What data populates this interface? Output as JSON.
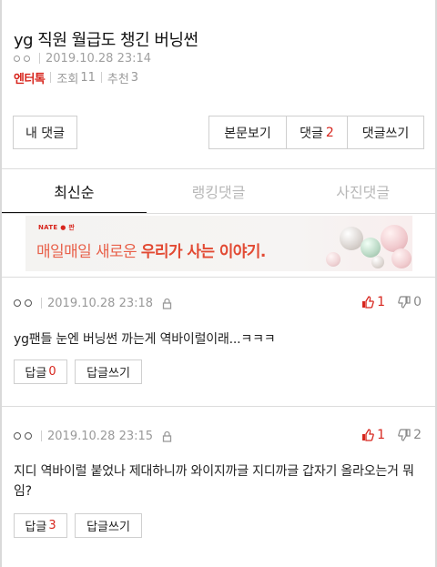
{
  "post": {
    "title": "yg 직원 월급도 챙긴 버닝썬",
    "author_icon": "circle-pair-icon",
    "datetime": "2019.10.28 23:14",
    "category": "엔터톡",
    "views_label": "조회",
    "views": "11",
    "recommend_label": "추천",
    "recommend": "3"
  },
  "actions": {
    "my_comments": "내 댓글",
    "view_post": "본문보기",
    "comments_label": "댓글",
    "comments_count": "2",
    "write_comment": "댓글쓰기"
  },
  "tabs": [
    {
      "label": "최신순",
      "active": true
    },
    {
      "label": "랭킹댓글",
      "active": false
    },
    {
      "label": "사진댓글",
      "active": false
    }
  ],
  "banner": {
    "brand": "NATE ● 판",
    "text_plain": "매일매일 새로운 ",
    "text_bold": "우리가 사는 이야기."
  },
  "comments": [
    {
      "datetime": "2019.10.28 23:18",
      "upvotes": "1",
      "downvotes": "0",
      "text": "yg팬들 눈엔 버닝썬 까는게 역바이럴이래...ㅋㅋㅋ",
      "reply_label": "답글",
      "reply_count": "0",
      "write_reply": "답글쓰기"
    },
    {
      "datetime": "2019.10.28 23:15",
      "upvotes": "1",
      "downvotes": "2",
      "text": "지디 역바이럴 붙었나 제대하니까 와이지까글 지디까글 갑자기 올라오는거 뭐임?",
      "reply_label": "답글",
      "reply_count": "3",
      "write_reply": "답글쓰기"
    }
  ],
  "colors": {
    "accent": "#d7261e",
    "muted": "#999999",
    "border": "#cfcfcf"
  }
}
